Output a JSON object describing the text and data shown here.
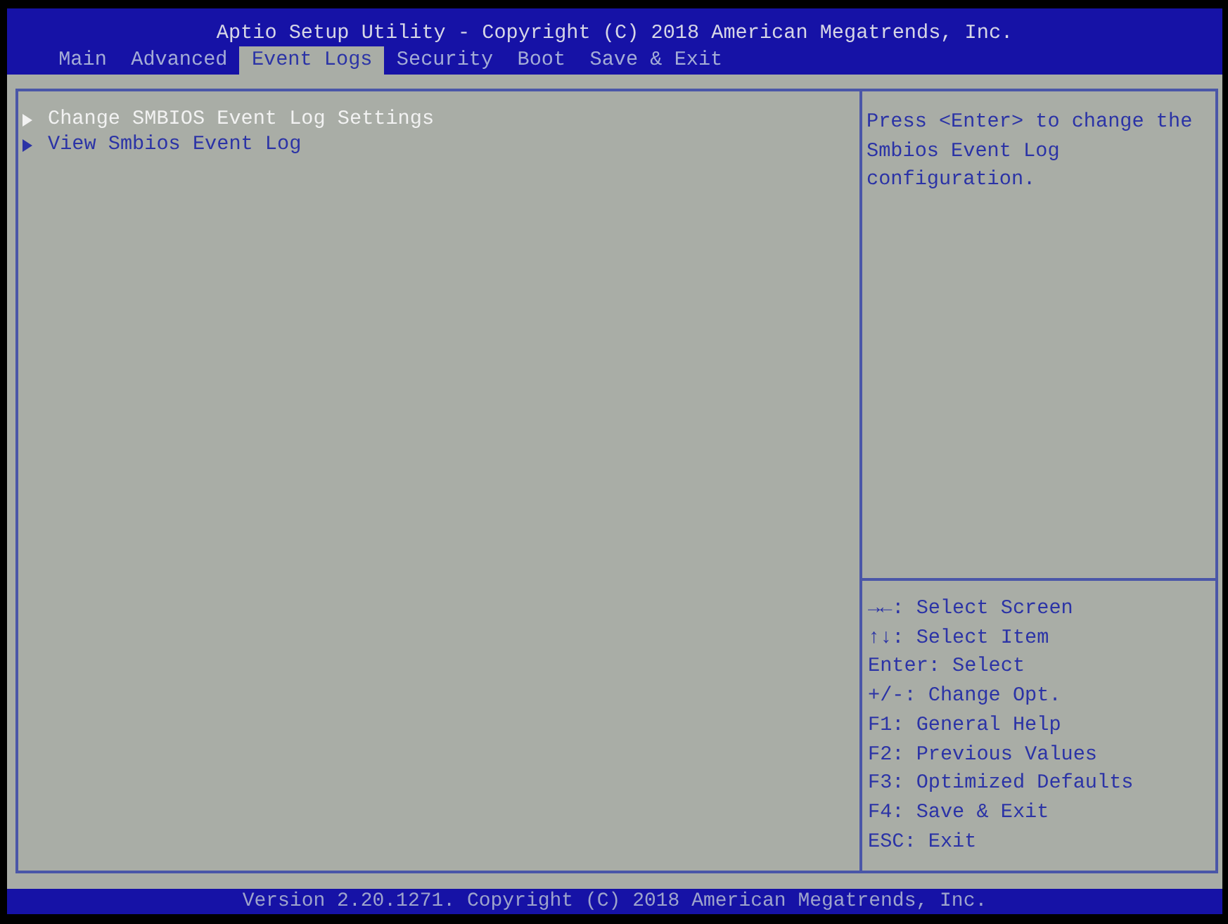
{
  "header": {
    "title": "Aptio Setup Utility - Copyright (C) 2018 American Megatrends, Inc.",
    "tabs": [
      {
        "label": "Main",
        "selected": false
      },
      {
        "label": "Advanced",
        "selected": false
      },
      {
        "label": "Event Logs",
        "selected": true
      },
      {
        "label": "Security",
        "selected": false
      },
      {
        "label": "Boot",
        "selected": false
      },
      {
        "label": "Save & Exit",
        "selected": false
      }
    ]
  },
  "menu": {
    "items": [
      {
        "label": "Change SMBIOS Event Log Settings",
        "selected": true
      },
      {
        "label": "View Smbios Event Log",
        "selected": false
      }
    ]
  },
  "help_panel": {
    "description": "Press <Enter> to change the Smbios Event Log configuration.",
    "key_hints": [
      "→←: Select Screen",
      "↑↓: Select Item",
      "Enter: Select",
      "+/-: Change Opt.",
      "F1: General Help",
      "F2: Previous Values",
      "F3: Optimized Defaults",
      "F4: Save & Exit",
      "ESC: Exit"
    ]
  },
  "footer": {
    "text": "Version 2.20.1271. Copyright (C) 2018 American Megatrends, Inc."
  }
}
